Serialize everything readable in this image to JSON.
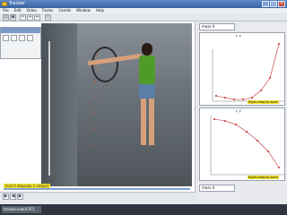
{
  "app": {
    "title": "Tracker"
  },
  "menu": [
    "File",
    "Edit",
    "Video",
    "Tracks",
    "Coords",
    "Window",
    "Help"
  ],
  "toolbar": {
    "track_select": "mass A",
    "frame_field": "1.000"
  },
  "video": {
    "fit_label": "trail 0 stepsize 1 (steps)"
  },
  "plots": [
    {
      "tab": "mass A",
      "axis_label": "t, x",
      "fit_label": "Right-drag to open",
      "y_ticks": [
        "-1.640",
        "-1.660",
        "-1.680",
        "-1.700",
        "-1.720",
        "-1.740",
        "-1.760",
        "-1.780",
        "-1.800"
      ]
    },
    {
      "axis_label": "t, y",
      "fit_label": "Right-drag to open",
      "y_ticks": [
        "2.0",
        "1.5",
        "1.0",
        "0.5",
        "0.0"
      ],
      "x_ticks": [
        "1.1",
        "1.2",
        "1.3",
        "1.4",
        "1.5",
        "1.6"
      ]
    }
  ],
  "bottom_tab": {
    "label": "mass A"
  },
  "taskbar": {
    "item": "tracker.exe(4.97)"
  },
  "colors": {
    "accent": "#3b63a3",
    "marker": "#e25a20",
    "fit": "#f2e22a"
  }
}
